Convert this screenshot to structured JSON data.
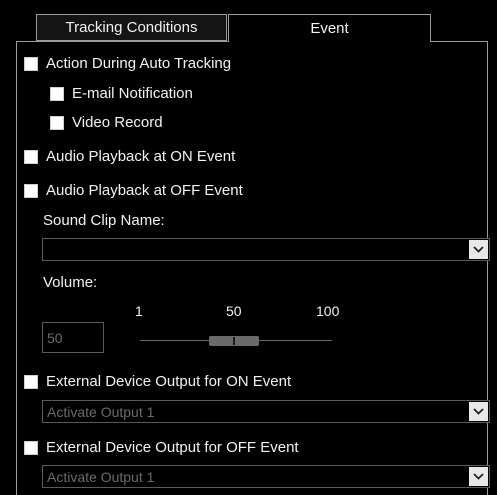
{
  "tabs": [
    {
      "label": "Tracking Conditions",
      "active": false
    },
    {
      "label": "Event",
      "active": true
    }
  ],
  "checkboxes": {
    "action_during_auto_tracking": {
      "label": "Action During Auto Tracking",
      "checked": false
    },
    "email_notification": {
      "label": "E-mail Notification",
      "checked": false
    },
    "video_record": {
      "label": "Video Record",
      "checked": false
    },
    "audio_on": {
      "label": "Audio Playback at ON Event",
      "checked": false
    },
    "audio_off": {
      "label": "Audio Playback at OFF Event",
      "checked": false
    },
    "ext_on": {
      "label": "External Device Output for ON Event",
      "checked": false
    },
    "ext_off": {
      "label": "External Device Output for OFF Event",
      "checked": false
    }
  },
  "sound_clip": {
    "label": "Sound Clip Name:",
    "value": ""
  },
  "volume": {
    "label": "Volume:",
    "value": "50",
    "min_label": "1",
    "mid_label": "50",
    "max_label": "100",
    "level": 50
  },
  "ext_on_select": {
    "value": "Activate Output 1"
  },
  "ext_off_select": {
    "value": "Activate Output 1"
  },
  "colors": {
    "background": "#000000",
    "text": "#f2f2f2",
    "disabled_text": "#6a6a6a",
    "border": "#9a9a9a"
  }
}
